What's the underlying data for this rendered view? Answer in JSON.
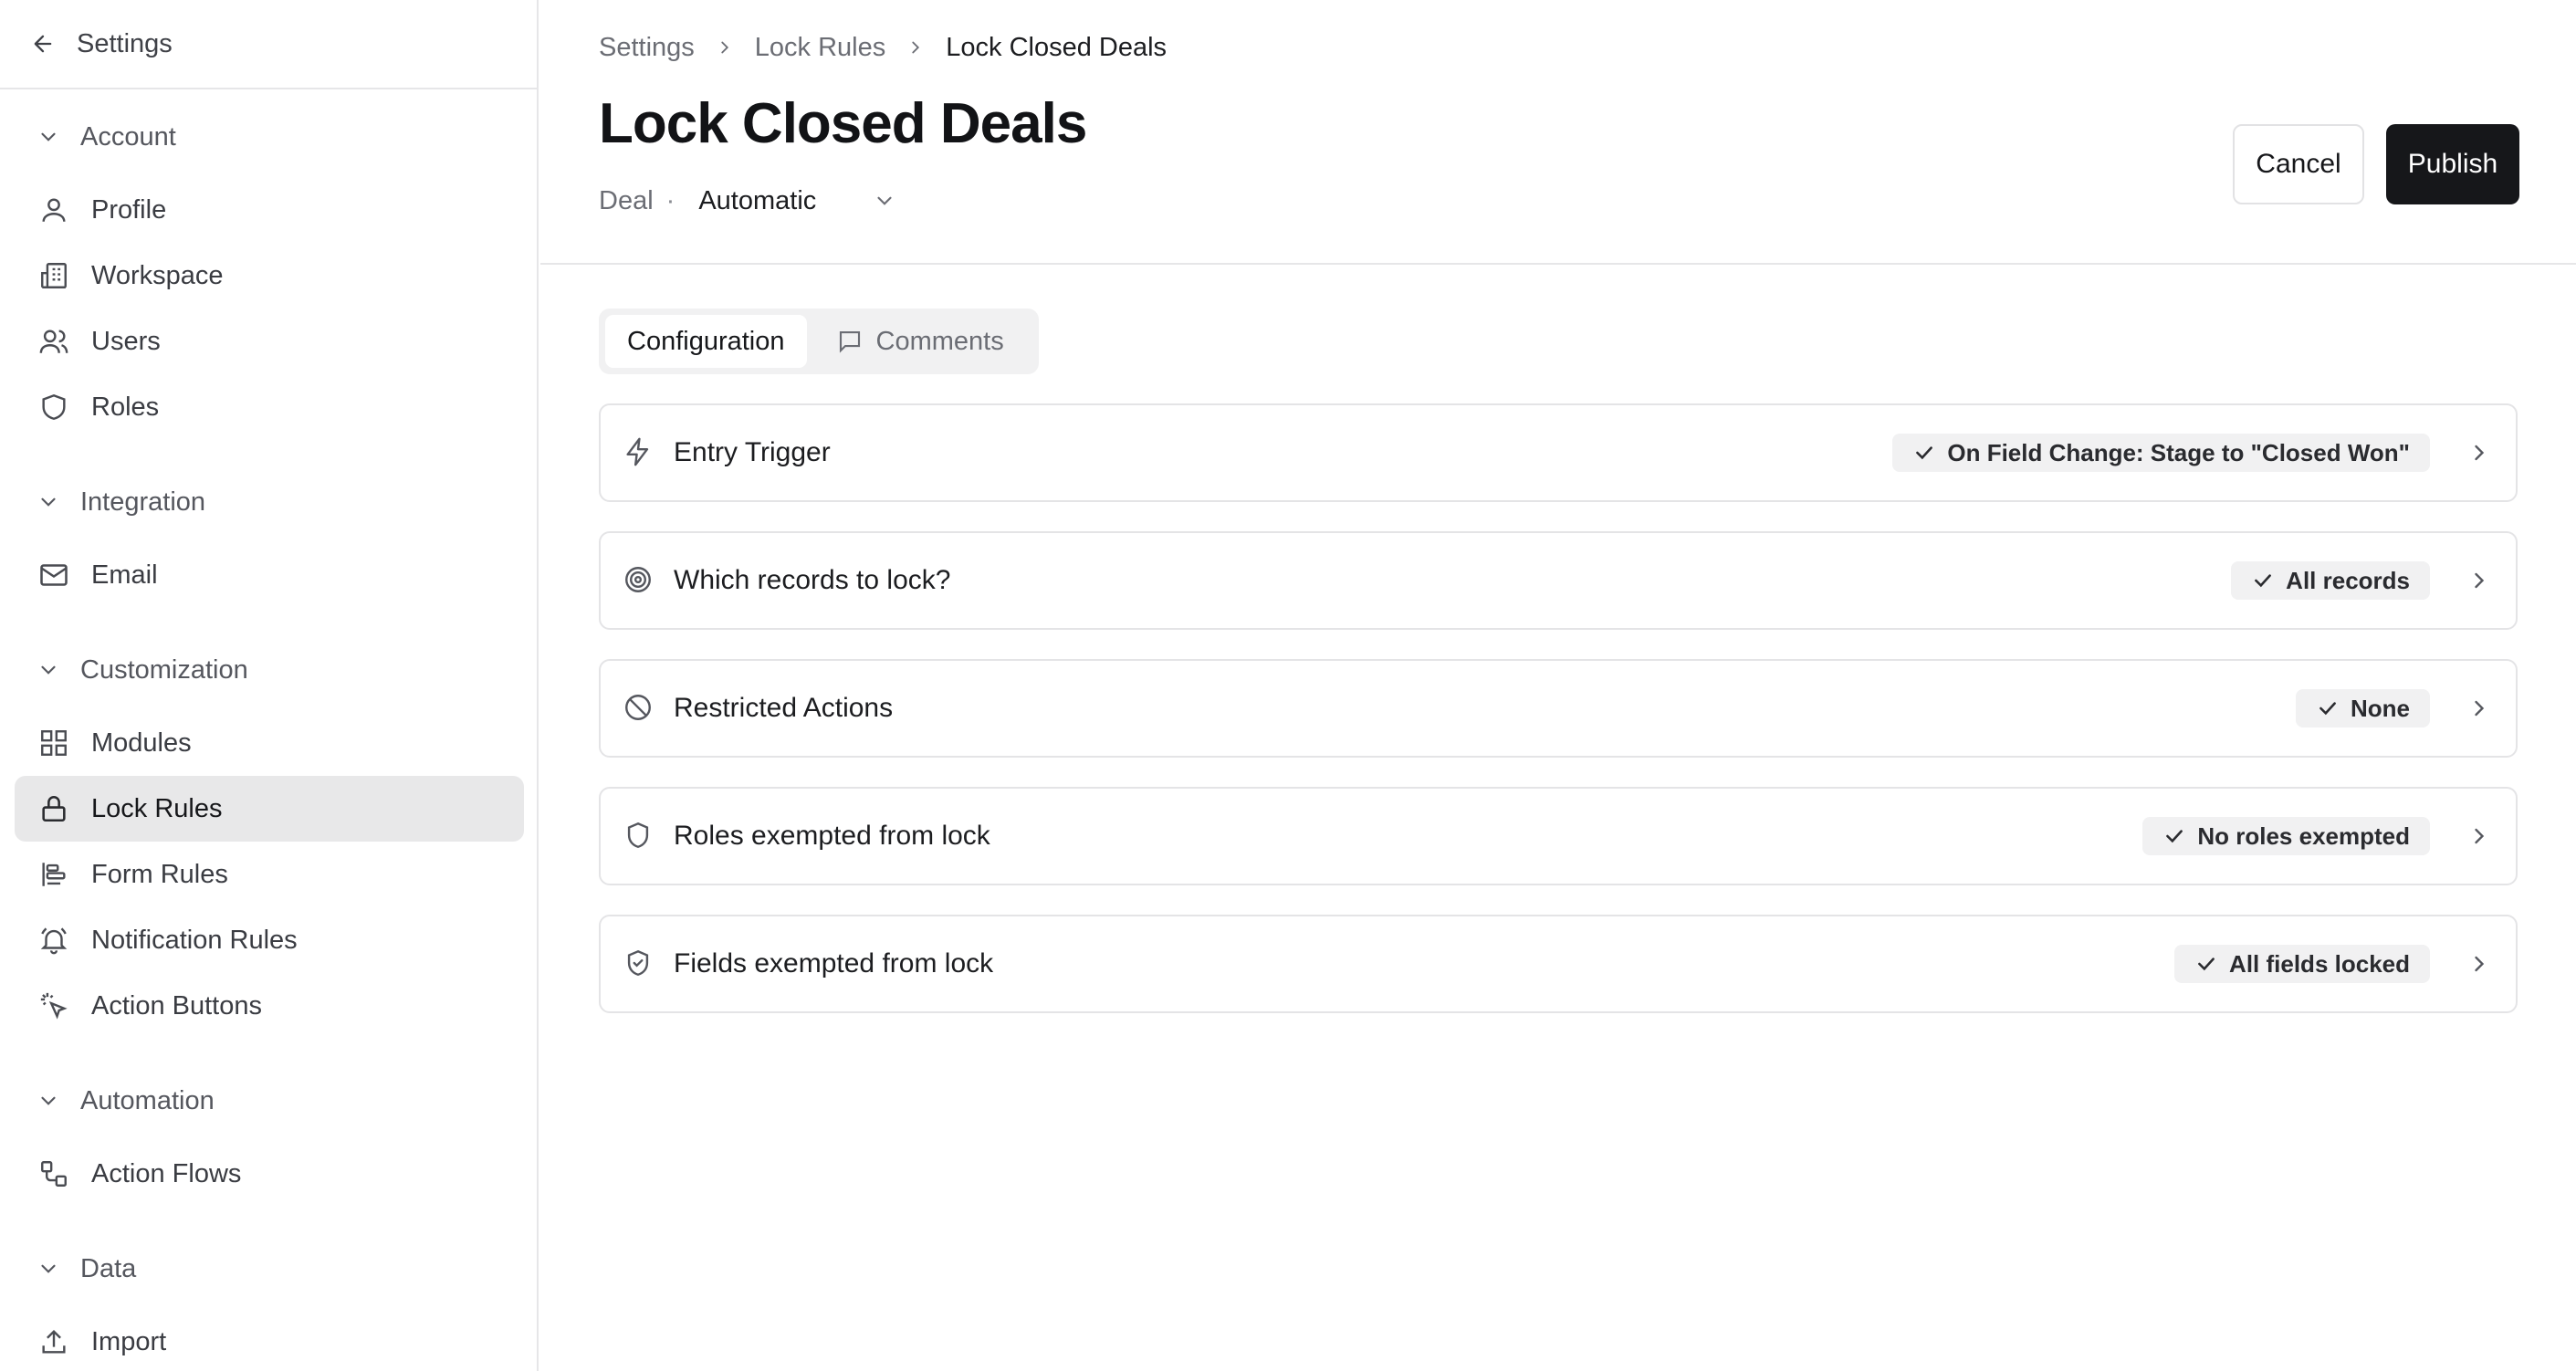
{
  "sidebar": {
    "header_title": "Settings",
    "groups": {
      "account": "Account",
      "integration": "Integration",
      "customization": "Customization",
      "automation": "Automation",
      "data": "Data"
    },
    "items": {
      "profile": "Profile",
      "workspace": "Workspace",
      "users": "Users",
      "roles": "Roles",
      "email": "Email",
      "modules": "Modules",
      "lock_rules": "Lock Rules",
      "form_rules": "Form Rules",
      "notification_rules": "Notification Rules",
      "action_buttons": "Action Buttons",
      "action_flows": "Action Flows",
      "import": "Import"
    },
    "active_item": "lock_rules"
  },
  "breadcrumb": [
    "Settings",
    "Lock Rules",
    "Lock Closed Deals"
  ],
  "page": {
    "title": "Lock Closed Deals",
    "object": "Deal",
    "separator": "·",
    "mode": "Automatic"
  },
  "actions": {
    "cancel": "Cancel",
    "publish": "Publish"
  },
  "tabs": [
    {
      "label": "Configuration",
      "active": true
    },
    {
      "label": "Comments",
      "active": false
    }
  ],
  "rules": [
    {
      "label": "Entry Trigger",
      "badge": "On Field Change: Stage to \"Closed Won\"",
      "icon": "bolt-icon"
    },
    {
      "label": "Which records to lock?",
      "badge": "All records",
      "icon": "target-icon"
    },
    {
      "label": "Restricted Actions",
      "badge": "None",
      "icon": "ban-icon"
    },
    {
      "label": "Roles exempted from lock",
      "badge": "No roles exempted",
      "icon": "shield-icon"
    },
    {
      "label": "Fields exempted from lock",
      "badge": "All fields locked",
      "icon": "shield-check-icon"
    }
  ],
  "colors": {
    "primary_button": "#16171a",
    "active_nav_bg": "#e8e8e9",
    "badge_bg": "#f1f1f2"
  }
}
